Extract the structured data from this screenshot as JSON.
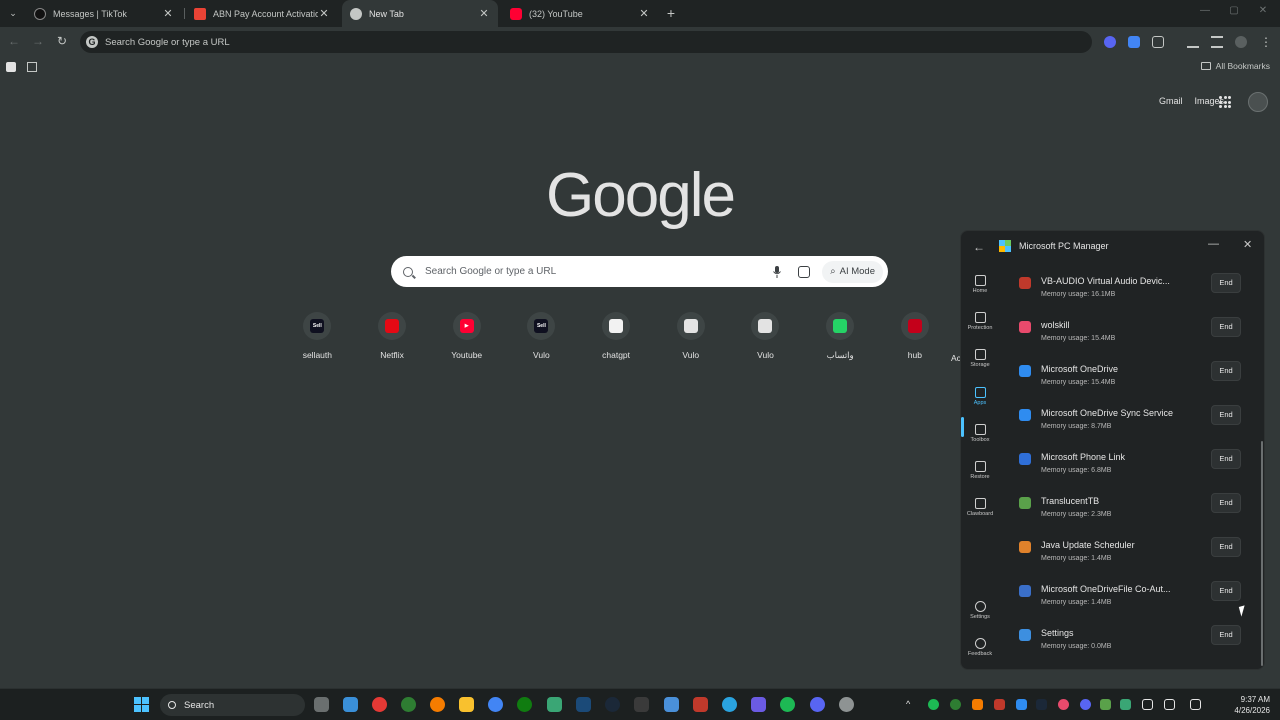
{
  "tabs": [
    {
      "title": "Messages | TikTok",
      "favicon_color": "#111111",
      "active": false
    },
    {
      "title": "ABN Pay Account Activation - ",
      "favicon_color": "#ea4335",
      "active": false
    },
    {
      "title": "New Tab",
      "favicon_color": "#c4c7c5",
      "active": true
    },
    {
      "title": "(32) YouTube",
      "favicon_color": "#ff0033",
      "active": false
    }
  ],
  "toolbar": {
    "omnibox_placeholder": "Search Google or type a URL"
  },
  "bookmarks": {
    "all_bookmarks_label": "All Bookmarks"
  },
  "ntp": {
    "links": [
      "Gmail",
      "Images"
    ],
    "logo": "Google",
    "search_placeholder": "Search Google or type a URL",
    "ai_mode_label": "AI Mode",
    "shortcuts": [
      {
        "label": "sellauth",
        "icon": "sellauth-icon",
        "color": "#0f1020",
        "text": "Sell"
      },
      {
        "label": "Netflix",
        "icon": "netflix-icon",
        "color": "#e50914",
        "text": ""
      },
      {
        "label": "Youtube",
        "icon": "youtube-icon",
        "color": "#ff0033",
        "text": "▶"
      },
      {
        "label": "Vulo",
        "icon": "vulo-icon",
        "color": "#0f1020",
        "text": "Sell"
      },
      {
        "label": "chatgpt",
        "icon": "chatgpt-icon",
        "color": "#f2f2f2",
        "text": ""
      },
      {
        "label": "Vulo",
        "icon": "vulo-icon",
        "color": "#e3e3e3",
        "text": ""
      },
      {
        "label": "Vulo",
        "icon": "vulo-icon",
        "color": "#e3e3e3",
        "text": ""
      },
      {
        "label": "واتساب",
        "icon": "whatsapp-icon",
        "color": "#25d366",
        "text": ""
      },
      {
        "label": "hub",
        "icon": "hub-icon",
        "color": "#c4001a",
        "text": ""
      }
    ],
    "partial_shortcut_label": "Ac"
  },
  "pc_manager": {
    "title": "Microsoft PC Manager",
    "sidebar": [
      {
        "label": "Home",
        "icon": "home-icon"
      },
      {
        "label": "Protection",
        "icon": "shield-icon"
      },
      {
        "label": "Storage",
        "icon": "storage-icon"
      },
      {
        "label": "Apps",
        "icon": "apps-icon",
        "selected": true
      },
      {
        "label": "Toolbox",
        "icon": "toolbox-icon"
      },
      {
        "label": "Restore",
        "icon": "wrench-icon"
      },
      {
        "label": "Clawboard",
        "icon": "clawboard-icon"
      }
    ],
    "sidebar_bottom": [
      {
        "label": "Settings",
        "icon": "gear-icon"
      },
      {
        "label": "Feedback",
        "icon": "feedback-icon"
      }
    ],
    "end_label": "End",
    "processes": [
      {
        "name": "VB-AUDIO Virtual Audio Devic...",
        "memory": "Memory usage: 16.1MB",
        "icon_color": "#c0392b"
      },
      {
        "name": "wolskill",
        "memory": "Memory usage: 15.4MB",
        "icon_color": "#e84a6c"
      },
      {
        "name": "Microsoft OneDrive",
        "memory": "Memory usage: 15.4MB",
        "icon_color": "#2f8cf0"
      },
      {
        "name": "Microsoft OneDrive Sync Service",
        "memory": "Memory usage: 8.7MB",
        "icon_color": "#2f8cf0"
      },
      {
        "name": "Microsoft Phone Link",
        "memory": "Memory usage: 6.8MB",
        "icon_color": "#2f6fd8"
      },
      {
        "name": "TranslucentTB",
        "memory": "Memory usage: 2.3MB",
        "icon_color": "#5aa14a"
      },
      {
        "name": "Java Update Scheduler",
        "memory": "Memory usage: 1.4MB",
        "icon_color": "#e0822b"
      },
      {
        "name": "Microsoft OneDriveFile Co-Aut...",
        "memory": "Memory usage: 1.4MB",
        "icon_color": "#3a6fc9"
      },
      {
        "name": "Settings",
        "memory": "Memory usage: 0.0MB",
        "icon_color": "#3d8fe0"
      }
    ]
  },
  "taskbar": {
    "search_label": "Search",
    "time": "9:37 AM",
    "date": "4/26/2026"
  }
}
